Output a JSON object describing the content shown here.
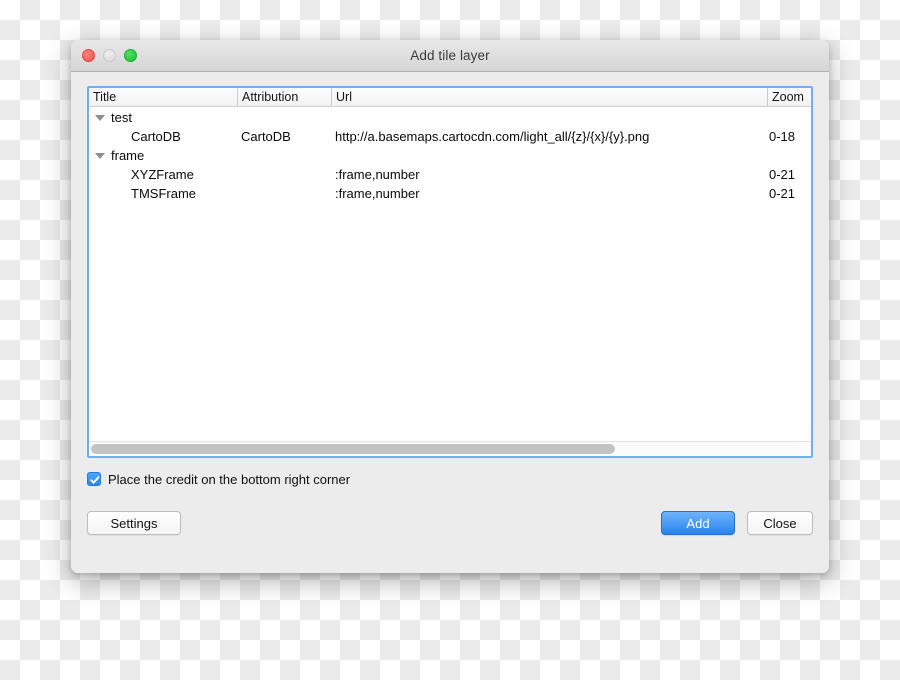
{
  "window": {
    "title": "Add tile layer",
    "traffic_lights": [
      "close-button",
      "minimize-button",
      "maximize-button"
    ]
  },
  "table": {
    "columns": [
      {
        "key": "title",
        "label": "Title"
      },
      {
        "key": "attribution",
        "label": "Attribution"
      },
      {
        "key": "url",
        "label": "Url"
      },
      {
        "key": "zoom",
        "label": "Zoom"
      }
    ],
    "rows": [
      {
        "kind": "group",
        "title": "test",
        "attribution": "",
        "url": "",
        "zoom": "",
        "expanded": true
      },
      {
        "kind": "child",
        "title": "CartoDB",
        "attribution": "CartoDB",
        "url": "http://a.basemaps.cartocdn.com/light_all/{z}/{x}/{y}.png",
        "zoom": "0-18"
      },
      {
        "kind": "group",
        "title": "frame",
        "attribution": "",
        "url": "",
        "zoom": "",
        "expanded": true
      },
      {
        "kind": "child",
        "title": "XYZFrame",
        "attribution": "",
        "url": ":frame,number",
        "zoom": "0-21"
      },
      {
        "kind": "child",
        "title": "TMSFrame",
        "attribution": "",
        "url": ":frame,number",
        "zoom": "0-21"
      }
    ]
  },
  "options": {
    "credit_checkbox_label": "Place the credit on the bottom right corner",
    "credit_checkbox_checked": true
  },
  "buttons": {
    "settings": "Settings",
    "add": "Add",
    "close": "Close"
  },
  "colors": {
    "accent": "#2a81ef",
    "focus_ring": "#6cb1f5",
    "window_bg": "#ececec",
    "titlebar_bg": "#e0e0e0",
    "traffic_close": "#f4524a",
    "traffic_min": "#d9d9d9",
    "traffic_max": "#1bc33a"
  }
}
